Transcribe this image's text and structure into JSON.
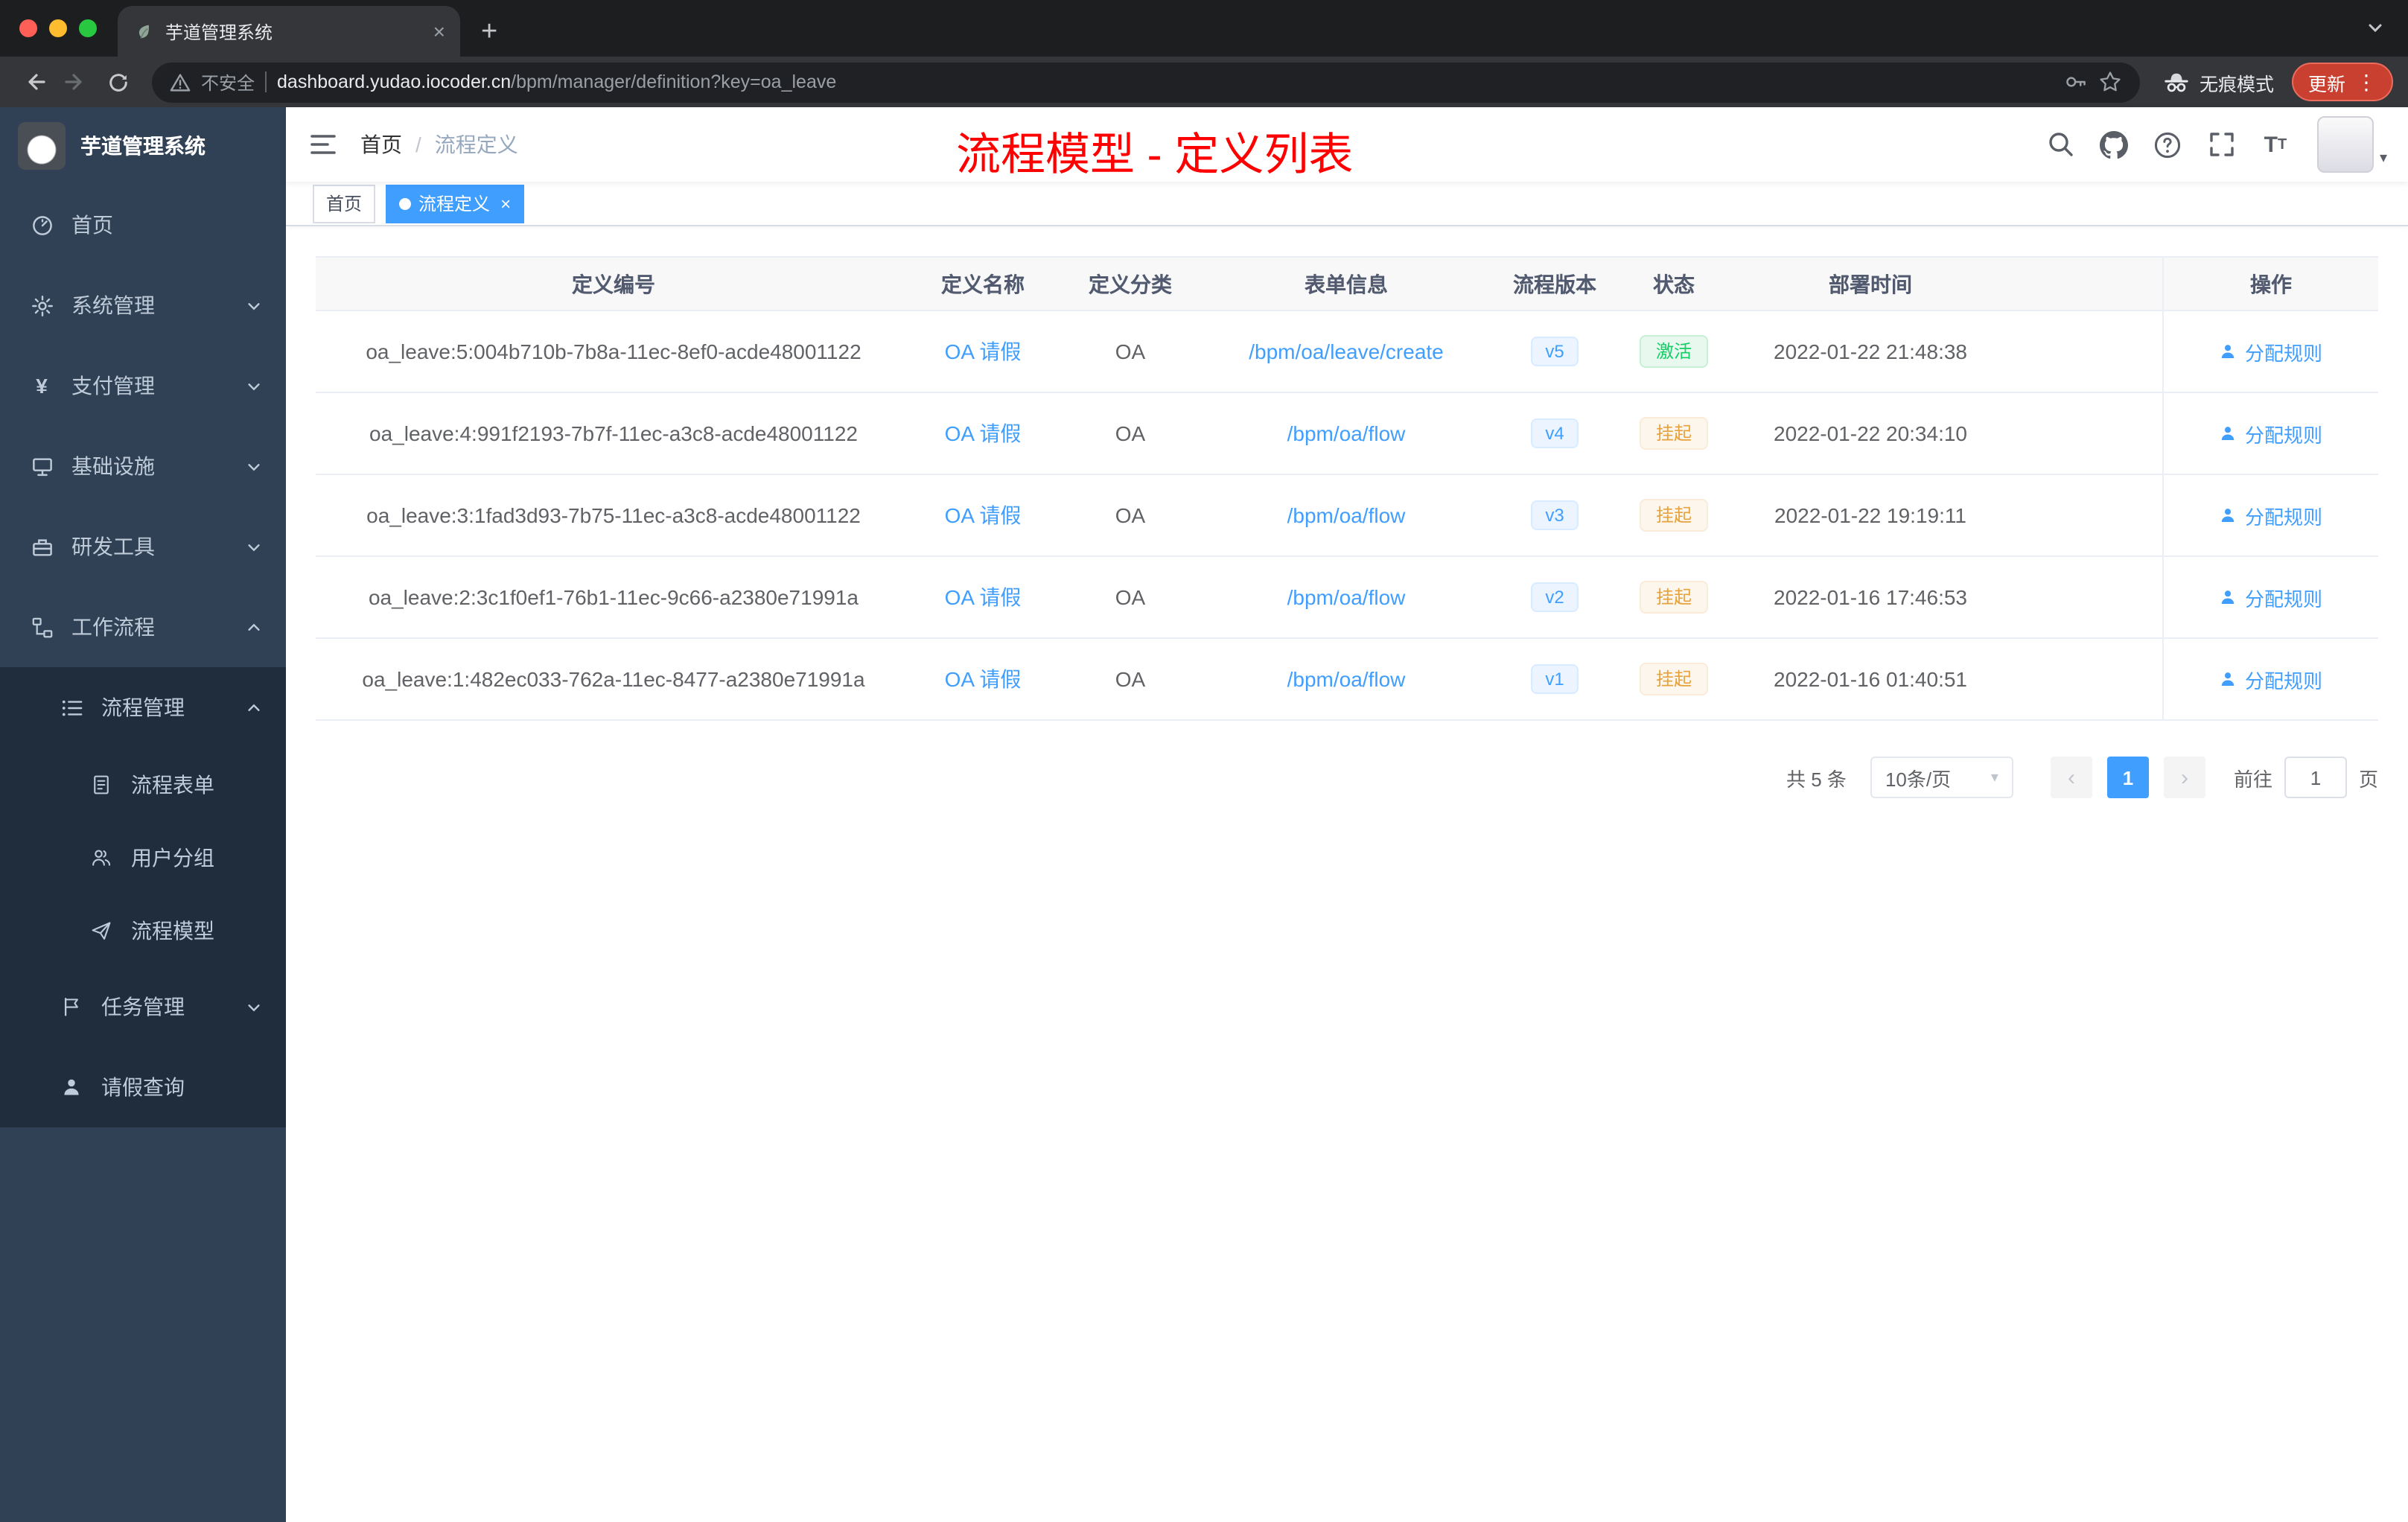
{
  "browser": {
    "tab_title": "芋道管理系统",
    "security_label": "不安全",
    "url_host": "dashboard.yudao.iocoder.cn",
    "url_path": "/bpm/manager/definition?key=oa_leave",
    "incognito_label": "无痕模式",
    "update_label": "更新"
  },
  "icons": {
    "new_tab": "+",
    "close": "×",
    "more": "⋮",
    "caret_down": "▾",
    "yen": "¥",
    "prev": "‹",
    "next": "›",
    "question": "?"
  },
  "sidebar": {
    "logo_title": "芋道管理系统",
    "items": [
      {
        "label": "首页",
        "icon": "dashboard-icon"
      },
      {
        "label": "系统管理",
        "icon": "gear-icon"
      },
      {
        "label": "支付管理",
        "icon": "yen-icon"
      },
      {
        "label": "基础设施",
        "icon": "infrastructure-icon"
      },
      {
        "label": "研发工具",
        "icon": "dev-tools-icon"
      },
      {
        "label": "工作流程",
        "icon": "workflow-icon"
      },
      {
        "label": "流程管理",
        "icon": "process-list-icon"
      },
      {
        "label": "流程表单",
        "icon": "form-icon"
      },
      {
        "label": "用户分组",
        "icon": "user-group-icon"
      },
      {
        "label": "流程模型",
        "icon": "paper-plane-icon"
      },
      {
        "label": "任务管理",
        "icon": "task-flag-icon"
      },
      {
        "label": "请假查询",
        "icon": "person-icon"
      }
    ]
  },
  "navbar": {
    "breadcrumb": {
      "home": "首页",
      "separator": "/",
      "current": "流程定义"
    },
    "annotation": "流程模型 - 定义列表"
  },
  "tags": {
    "home": "首页",
    "active": "流程定义"
  },
  "table": {
    "columns": [
      "定义编号",
      "定义名称",
      "定义分类",
      "表单信息",
      "流程版本",
      "状态",
      "部署时间",
      "操作"
    ],
    "action_label": "分配规则",
    "rows": [
      {
        "id": "oa_leave:5:004b710b-7b8a-11ec-8ef0-acde48001122",
        "name": "OA 请假",
        "category": "OA",
        "form": "/bpm/oa/leave/create",
        "version": "v5",
        "status": "激活",
        "time": "2022-01-22 21:48:38"
      },
      {
        "id": "oa_leave:4:991f2193-7b7f-11ec-a3c8-acde48001122",
        "name": "OA 请假",
        "category": "OA",
        "form": "/bpm/oa/flow",
        "version": "v4",
        "status": "挂起",
        "time": "2022-01-22 20:34:10"
      },
      {
        "id": "oa_leave:3:1fad3d93-7b75-11ec-a3c8-acde48001122",
        "name": "OA 请假",
        "category": "OA",
        "form": "/bpm/oa/flow",
        "version": "v3",
        "status": "挂起",
        "time": "2022-01-22 19:19:11"
      },
      {
        "id": "oa_leave:2:3c1f0ef1-76b1-11ec-9c66-a2380e71991a",
        "name": "OA 请假",
        "category": "OA",
        "form": "/bpm/oa/flow",
        "version": "v2",
        "status": "挂起",
        "time": "2022-01-16 17:46:53"
      },
      {
        "id": "oa_leave:1:482ec033-762a-11ec-8477-a2380e71991a",
        "name": "OA 请假",
        "category": "OA",
        "form": "/bpm/oa/flow",
        "version": "v1",
        "status": "挂起",
        "time": "2022-01-16 01:40:51"
      }
    ]
  },
  "pagination": {
    "total_label": "共 5 条",
    "page_size": "10条/页",
    "page": "1",
    "goto_label": "前往",
    "goto_value": "1",
    "goto_unit": "页"
  },
  "colors": {
    "accent": "#409eff",
    "annotation_red": "#fe0000",
    "success_text": "#13ce66",
    "warning_text": "#e6a23c",
    "sidebar_bg": "#304156",
    "submenu_bg": "#1f2d3d"
  }
}
